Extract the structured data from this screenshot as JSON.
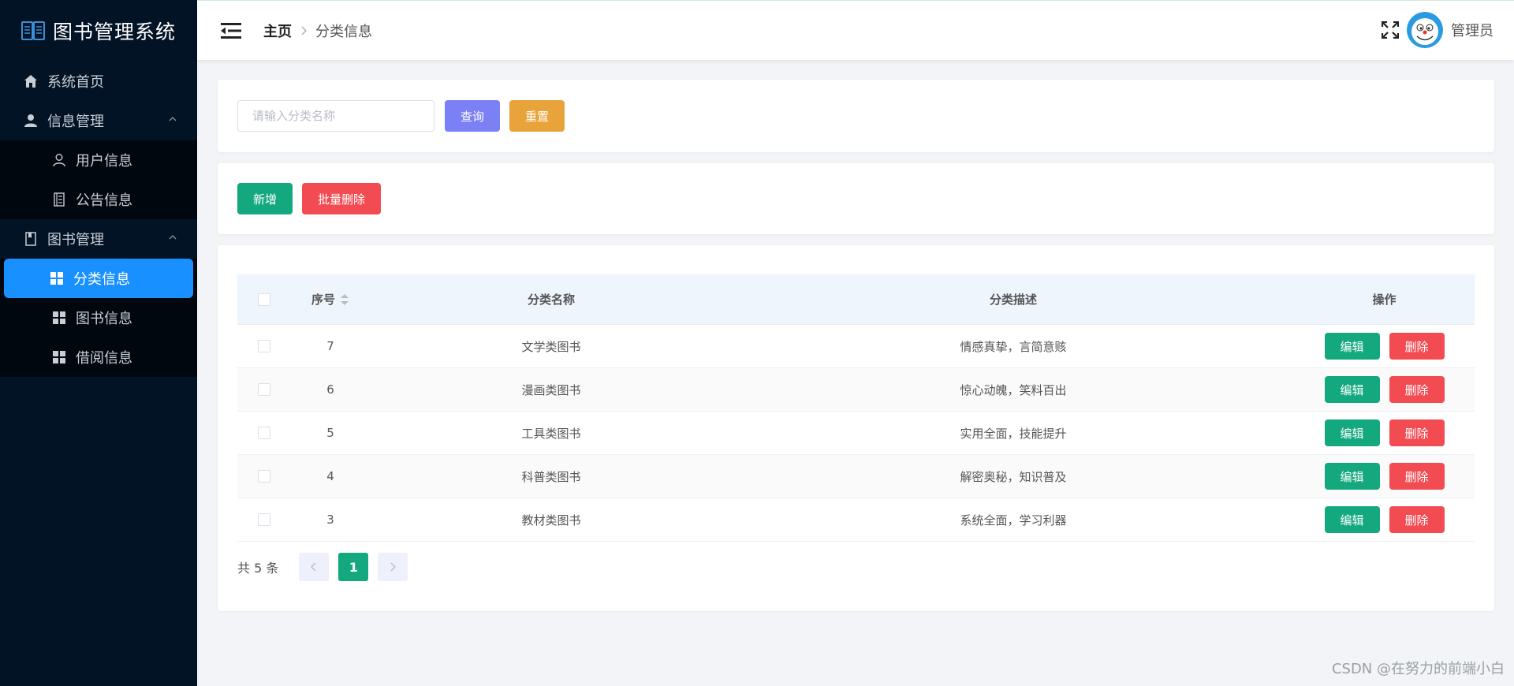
{
  "app": {
    "title": "图书管理系统"
  },
  "sidebar": {
    "items": [
      {
        "label": "系统首页",
        "icon": "home-icon"
      },
      {
        "label": "信息管理",
        "icon": "user-icon",
        "expanded": true,
        "children": [
          {
            "label": "用户信息",
            "icon": "user-outline-icon"
          },
          {
            "label": "公告信息",
            "icon": "document-icon"
          }
        ]
      },
      {
        "label": "图书管理",
        "icon": "book-icon",
        "expanded": true,
        "children": [
          {
            "label": "分类信息",
            "icon": "grid-icon",
            "active": true
          },
          {
            "label": "图书信息",
            "icon": "grid-icon"
          },
          {
            "label": "借阅信息",
            "icon": "grid-icon"
          }
        ]
      }
    ]
  },
  "header": {
    "breadcrumb": {
      "home": "主页",
      "current": "分类信息"
    },
    "user": {
      "name": "管理员"
    }
  },
  "search": {
    "placeholder": "请输入分类名称",
    "value": "",
    "query_label": "查询",
    "reset_label": "重置"
  },
  "toolbar": {
    "add_label": "新增",
    "batch_delete_label": "批量删除"
  },
  "table": {
    "columns": {
      "seq": "序号",
      "name": "分类名称",
      "desc": "分类描述",
      "op": "操作"
    },
    "rows": [
      {
        "seq": "7",
        "name": "文学类图书",
        "desc": "情感真挚，言简意赅"
      },
      {
        "seq": "6",
        "name": "漫画类图书",
        "desc": "惊心动魄，笑料百出"
      },
      {
        "seq": "5",
        "name": "工具类图书",
        "desc": "实用全面，技能提升"
      },
      {
        "seq": "4",
        "name": "科普类图书",
        "desc": "解密奥秘，知识普及"
      },
      {
        "seq": "3",
        "name": "教材类图书",
        "desc": "系统全面，学习利器"
      }
    ],
    "edit_label": "编辑",
    "delete_label": "删除"
  },
  "pagination": {
    "total_text": "共 5 条",
    "current_page": "1"
  },
  "watermark": "CSDN @在努力的前端小白",
  "colors": {
    "sidebar_bg": "#031326",
    "active": "#1890ff",
    "primary_green": "#13a87d",
    "danger": "#f24b52",
    "query": "#7b80f5",
    "reset": "#e8a43a"
  }
}
